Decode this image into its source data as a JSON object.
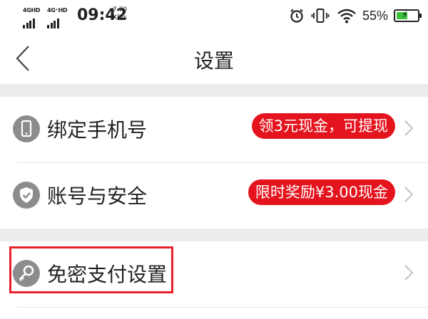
{
  "status_bar": {
    "network_1": "4GHD",
    "network_2": "4G⁺HD",
    "time": "09:42",
    "speed_value": "7.70",
    "speed_unit": "KB/s",
    "battery_percent": "55%",
    "battery_level": 0.55,
    "icons": [
      "alarm-icon",
      "vibrate-icon",
      "wifi-icon",
      "battery-charging-icon"
    ]
  },
  "nav": {
    "title": "设置",
    "back_icon": "chevron-left-icon"
  },
  "settings": {
    "items": [
      {
        "label": "绑定手机号",
        "badge": "领3元现金，可提现",
        "icon": "phone-icon"
      },
      {
        "label": "账号与安全",
        "badge": "限时奖励¥3.00现金",
        "icon": "shield-check-icon"
      },
      {
        "label": "免密支付设置",
        "badge": "",
        "icon": "key-icon"
      }
    ]
  },
  "colors": {
    "badge_bg": "#e4141e",
    "icon_bg": "#8c8c8c",
    "section_gap": "#ececec",
    "highlight_border": "#e8202a",
    "battery_fill": "#3cc23c"
  }
}
